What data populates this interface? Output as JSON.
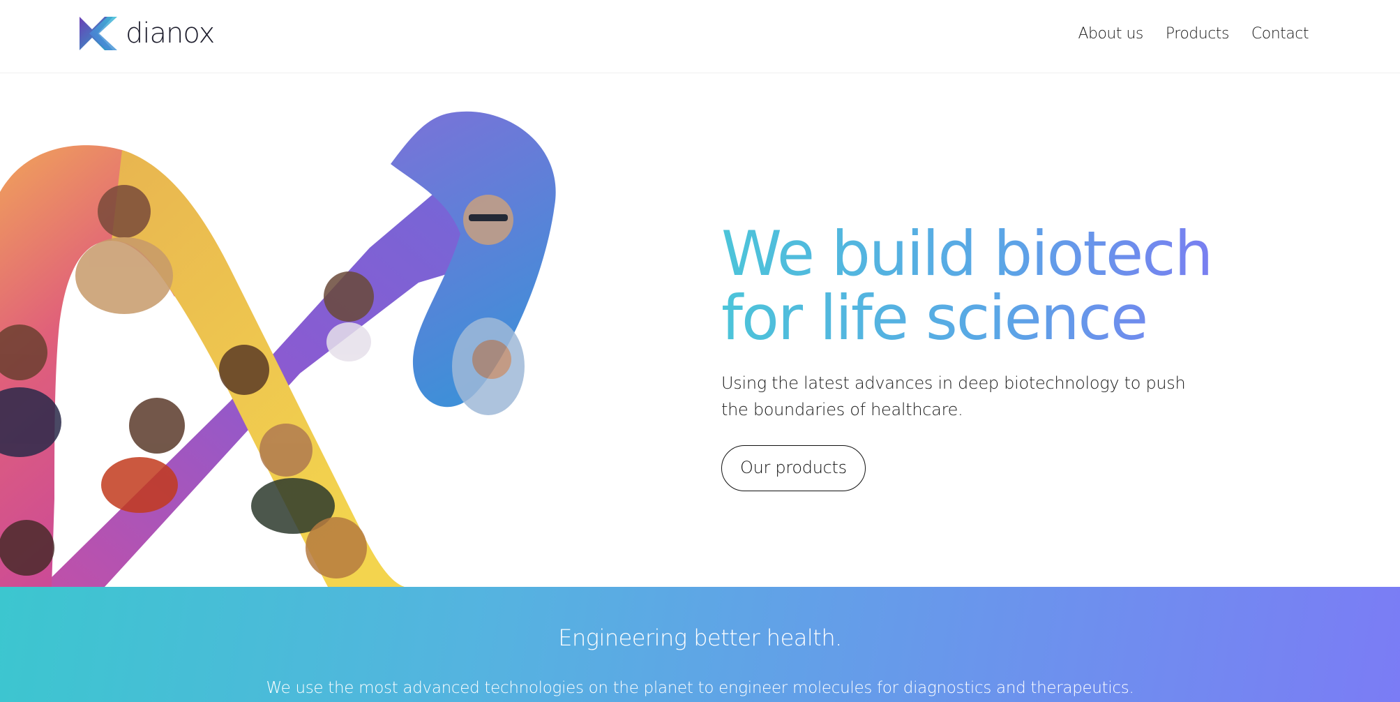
{
  "header": {
    "logo_text": "dianox",
    "nav": [
      {
        "label": "About us"
      },
      {
        "label": "Products"
      },
      {
        "label": "Contact"
      }
    ]
  },
  "hero": {
    "title_line1": "We build biotech",
    "title_line2": "for life science",
    "subtitle": "Using the latest advances in deep biotechnology to push the boundaries of healthcare.",
    "cta_label": "Our products"
  },
  "banner": {
    "title": "Engineering better health.",
    "text": "We use the most advanced technologies on the planet to engineer molecules for diagnostics and therapeutics."
  },
  "colors": {
    "title_gradient_start": "#4cc4d9",
    "title_gradient_end": "#7b7cf1",
    "banner_start": "#3cc6cf",
    "banner_end": "#7b7cf5",
    "ribbon_left": "#e05a8a",
    "ribbon_yellow": "#f2c94c",
    "ribbon_purple": "#8a5bd1",
    "ribbon_blue": "#4c8de0"
  }
}
